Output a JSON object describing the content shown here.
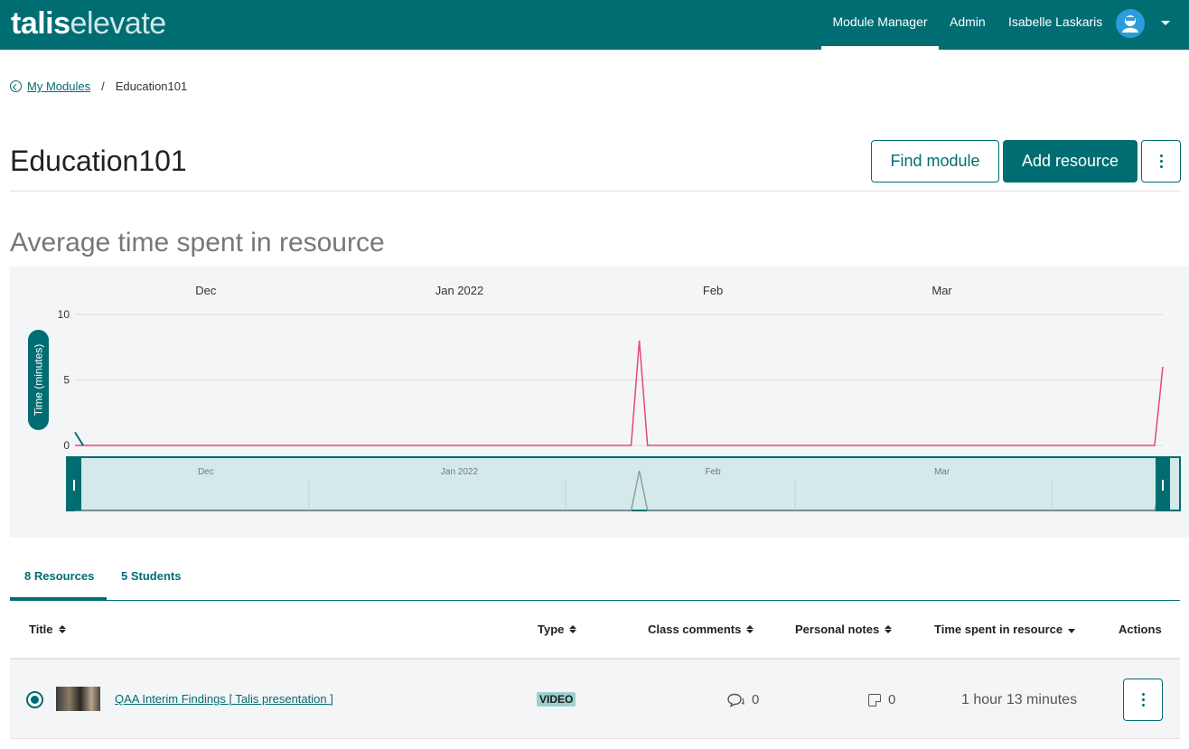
{
  "app": {
    "logo_bold": "talis",
    "logo_light": "elevate",
    "nav": [
      {
        "label": "Module Manager",
        "active": true
      },
      {
        "label": "Admin",
        "active": false
      },
      {
        "label": "Isabelle Laskaris",
        "active": false
      }
    ],
    "user_icon": "user-avatar-icon",
    "menu_icon": "caret-down-icon"
  },
  "breadcrumb": {
    "back_label": "My Modules",
    "separator": "/",
    "current": "Education101"
  },
  "page": {
    "title": "Education101",
    "find_button": "Find module",
    "add_button": "Add resource",
    "more_icon": "kebab-menu-icon"
  },
  "chart_section": {
    "heading": "Average time spent in resource"
  },
  "chart_data": {
    "type": "line",
    "ylabel": "Time (minutes)",
    "ylim": [
      0,
      10
    ],
    "yticks": [
      0,
      5,
      10
    ],
    "x_month_labels": [
      "Dec",
      "Jan 2022",
      "Feb",
      "Mar"
    ],
    "grid": true,
    "series": [
      {
        "color": "#e8477a",
        "x": [
          "2021-11-15",
          "2021-11-16",
          "2022-01-22",
          "2022-01-23",
          "2022-01-24",
          "2022-03-27",
          "2022-03-28"
        ],
        "y": [
          0,
          0,
          0,
          8,
          0,
          0,
          6
        ]
      },
      {
        "color": "#006d72",
        "x": [
          "2021-11-15",
          "2021-11-16"
        ],
        "y": [
          1,
          0
        ]
      }
    ],
    "navigator": {
      "labels": [
        "Dec",
        "Jan 2022",
        "Feb",
        "Mar"
      ],
      "fill": "#d4eaea",
      "border": "#006d72"
    }
  },
  "tabs": [
    {
      "label": "8 Resources",
      "active": true
    },
    {
      "label": "5 Students",
      "active": false
    }
  ],
  "table": {
    "headers": {
      "title": "Title",
      "type": "Type",
      "comments": "Class comments",
      "notes": "Personal notes",
      "time": "Time spent in resource",
      "actions": "Actions"
    },
    "rows": [
      {
        "title": "QAA Interim Findings [ Talis presentation ]",
        "type": "VIDEO",
        "comments": "0",
        "notes": "0",
        "time": "1 hour 13 minutes"
      }
    ]
  },
  "colors": {
    "brand": "#006d72",
    "line": "#e8477a"
  }
}
